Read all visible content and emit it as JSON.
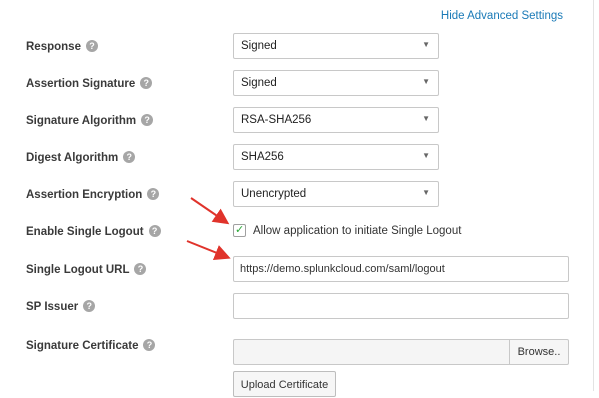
{
  "header": {
    "advanced_link": "Hide Advanced Settings"
  },
  "fields": {
    "response": {
      "label": "Response",
      "value": "Signed"
    },
    "assertion_signature": {
      "label": "Assertion Signature",
      "value": "Signed"
    },
    "signature_algorithm": {
      "label": "Signature Algorithm",
      "value": "RSA-SHA256"
    },
    "digest_algorithm": {
      "label": "Digest Algorithm",
      "value": "SHA256"
    },
    "assertion_encryption": {
      "label": "Assertion Encryption",
      "value": "Unencrypted"
    },
    "single_logout": {
      "label": "Enable Single Logout",
      "checkbox_label": "Allow application to initiate Single Logout",
      "checked": true
    },
    "single_logout_url": {
      "label": "Single Logout URL",
      "value": "https://demo.splunkcloud.com/saml/logout"
    },
    "sp_issuer": {
      "label": "SP Issuer",
      "value": ""
    },
    "signature_certificate": {
      "label": "Signature Certificate",
      "browse_label": "Browse..",
      "upload_label": "Upload Certificate"
    }
  },
  "icons": {
    "help": "question-circle-icon",
    "caret": "caret-down-icon",
    "check": "checkmark-icon",
    "arrow": "red-arrow-annotation"
  },
  "colors": {
    "link": "#1a7ab7",
    "arrow": "#e0332b",
    "check": "#2aa838"
  }
}
